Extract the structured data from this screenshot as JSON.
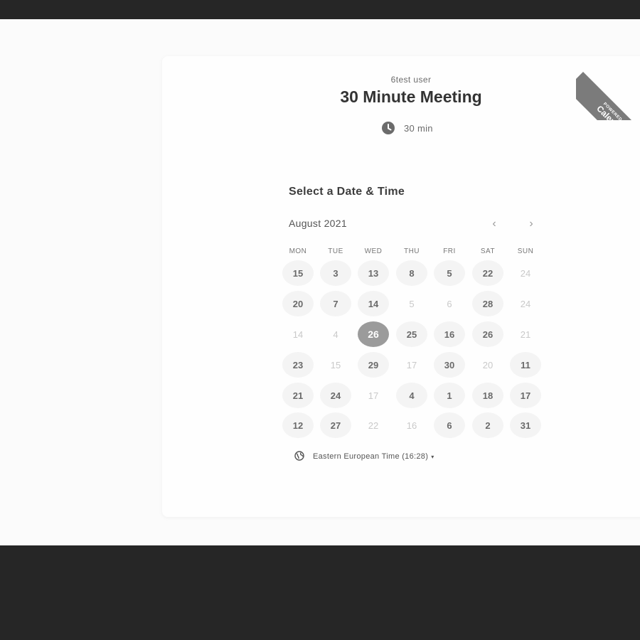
{
  "ribbon": {
    "small": "POWERED BY",
    "big": "Calendly"
  },
  "header": {
    "user_name": "6test user",
    "event_title": "30 Minute Meeting",
    "duration": "30 min"
  },
  "calendar": {
    "section_title": "Select a Date & Time",
    "month": "August 2021",
    "weekdays": [
      "MON",
      "TUE",
      "WED",
      "THU",
      "FRI",
      "SAT",
      "SUN"
    ],
    "weeks": [
      [
        {
          "label": "15",
          "state": "available"
        },
        {
          "label": "3",
          "state": "available"
        },
        {
          "label": "13",
          "state": "available"
        },
        {
          "label": "8",
          "state": "available"
        },
        {
          "label": "5",
          "state": "available"
        },
        {
          "label": "22",
          "state": "available"
        },
        {
          "label": "24",
          "state": "unavailable"
        }
      ],
      [
        {
          "label": "20",
          "state": "available"
        },
        {
          "label": "7",
          "state": "available"
        },
        {
          "label": "14",
          "state": "available"
        },
        {
          "label": "5",
          "state": "unavailable"
        },
        {
          "label": "6",
          "state": "unavailable"
        },
        {
          "label": "28",
          "state": "available"
        },
        {
          "label": "24",
          "state": "unavailable"
        }
      ],
      [
        {
          "label": "14",
          "state": "unavailable"
        },
        {
          "label": "4",
          "state": "unavailable"
        },
        {
          "label": "26",
          "state": "selected"
        },
        {
          "label": "25",
          "state": "available"
        },
        {
          "label": "16",
          "state": "available"
        },
        {
          "label": "26",
          "state": "available"
        },
        {
          "label": "21",
          "state": "unavailable"
        }
      ],
      [
        {
          "label": "23",
          "state": "available"
        },
        {
          "label": "15",
          "state": "unavailable"
        },
        {
          "label": "29",
          "state": "available"
        },
        {
          "label": "17",
          "state": "unavailable"
        },
        {
          "label": "30",
          "state": "available"
        },
        {
          "label": "20",
          "state": "unavailable"
        },
        {
          "label": "11",
          "state": "available"
        }
      ],
      [
        {
          "label": "21",
          "state": "available"
        },
        {
          "label": "24",
          "state": "available"
        },
        {
          "label": "17",
          "state": "unavailable"
        },
        {
          "label": "4",
          "state": "available"
        },
        {
          "label": "1",
          "state": "available"
        },
        {
          "label": "18",
          "state": "available"
        },
        {
          "label": "17",
          "state": "available"
        }
      ],
      [
        {
          "label": "12",
          "state": "available"
        },
        {
          "label": "27",
          "state": "available"
        },
        {
          "label": "22",
          "state": "unavailable"
        },
        {
          "label": "16",
          "state": "unavailable"
        },
        {
          "label": "6",
          "state": "available"
        },
        {
          "label": "2",
          "state": "available"
        },
        {
          "label": "31",
          "state": "available"
        }
      ]
    ]
  },
  "timezone": {
    "label": "Eastern European Time (16:28)"
  },
  "icons": {
    "clock": "clock-icon",
    "globe": "globe-icon",
    "prev": "chevron-left-icon",
    "next": "chevron-right-icon"
  }
}
